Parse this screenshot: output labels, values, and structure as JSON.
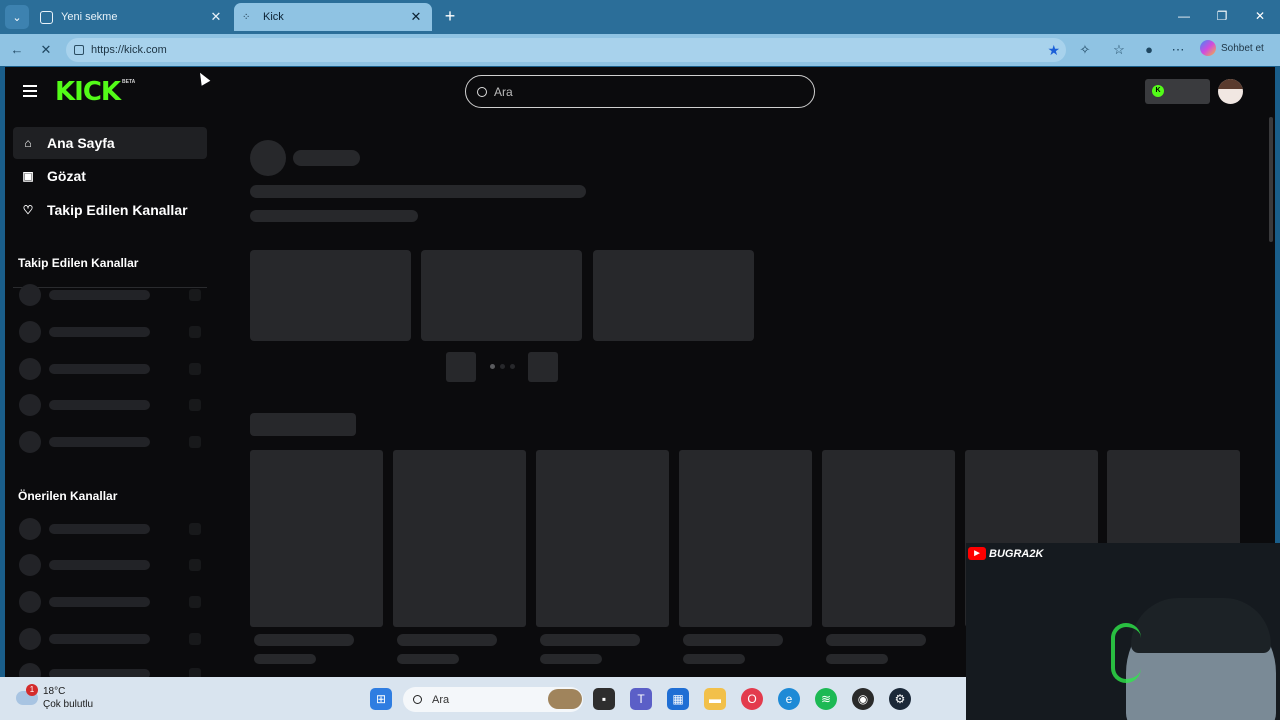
{
  "browser": {
    "tabs": [
      {
        "label": "Yeni sekme",
        "active": false
      },
      {
        "label": "Kick",
        "active": true
      }
    ],
    "url": "https://kick.com",
    "chat_label": "Sohbet et"
  },
  "kick": {
    "logo": "KICK",
    "beta": "BETA",
    "search_placeholder": "Ara",
    "nav": [
      {
        "label": "Ana Sayfa",
        "icon": "home-icon",
        "active": true
      },
      {
        "label": "Gözat",
        "icon": "browse-icon",
        "active": false
      },
      {
        "label": "Takip Edilen Kanallar",
        "icon": "heart-icon",
        "active": false
      }
    ],
    "sections": {
      "followed": "Takip Edilen Kanallar",
      "recommended": "Önerilen Kanallar"
    }
  },
  "webcam": {
    "channel": "BUGRA2K"
  },
  "taskbar": {
    "temperature": "18°C",
    "condition": "Çok bulutlu",
    "notification_count": "1",
    "search_label": "Ara"
  },
  "colors": {
    "accent": "#53fc18",
    "page_bg": "#0b0b0d",
    "skeleton": "#27282b"
  }
}
